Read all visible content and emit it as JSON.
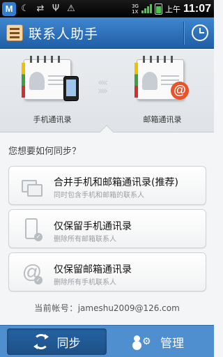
{
  "status_bar": {
    "network_top": "3G",
    "network_bottom": "1X",
    "ampm": "上午",
    "time": "11:07",
    "app_badge": "M"
  },
  "header": {
    "title": "联系人助手"
  },
  "hero": {
    "left_label": "手机通讯录",
    "right_label": "邮箱通讯录",
    "mail_symbol": "@"
  },
  "question": "您想要如何同步？",
  "options": [
    {
      "title": "合并手机和邮箱通讯录(推荐)",
      "subtitle": "同时包含手机和邮箱的联系人",
      "icon": "merge-icon"
    },
    {
      "title": "仅保留手机通讯录",
      "subtitle": "删除所有邮箱联系人",
      "icon": "phone-icon"
    },
    {
      "title": "仅保留邮箱通讯录",
      "subtitle": "删除所有手机联系人",
      "icon": "at-icon"
    }
  ],
  "account": {
    "label": "当前帐号：",
    "email": "jameshu2009@126.com"
  },
  "tabs": {
    "sync_label": "同步",
    "manage_label": "管理"
  },
  "colors": {
    "header_blue": "#2f72bb",
    "tab_blue": "#4f8ecf",
    "mail_orange": "#e8532a"
  }
}
